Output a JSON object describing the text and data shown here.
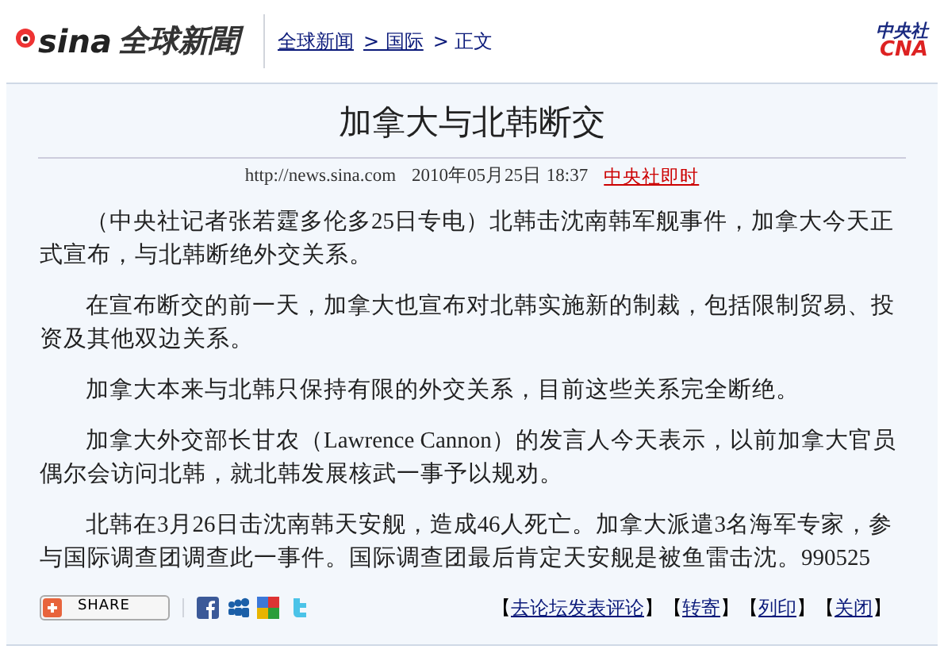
{
  "header": {
    "logo_word": "sina",
    "logo_text": "全球新聞",
    "breadcrumb": [
      {
        "label": "全球新闻",
        "link": true
      },
      {
        "label": "> 国际",
        "link": true
      },
      {
        "label": "> 正文",
        "link": false
      }
    ],
    "partner_logo": {
      "line1": "中央社",
      "line2": "CNA"
    }
  },
  "article": {
    "title": "加拿大与北韩断交",
    "source_url": "http://news.sina.com",
    "date": "2010年05月25日 18:37",
    "source": "中央社即时",
    "paragraphs": [
      "（中央社记者张若霆多伦多25日专电）北韩击沈南韩军舰事件，加拿大今天正式宣布，与北韩断绝外交关系。",
      "在宣布断交的前一天，加拿大也宣布对北韩实施新的制裁，包括限制贸易、投资及其他双边关系。",
      "加拿大本来与北韩只保持有限的外交关系，目前这些关系完全断绝。",
      "加拿大外交部长甘农（Lawrence Cannon）的发言人今天表示，以前加拿大官员偶尔会访问北韩，就北韩发展核武一事予以规劝。",
      "北韩在3月26日击沈南韩天安舰，造成46人死亡。加拿大派遣3名海军专家，参与国际调查团调查此一事件。国际调查团最后肯定天安舰是被鱼雷击沈。990525"
    ]
  },
  "footer": {
    "share_label": "SHARE",
    "social": [
      {
        "kind": "facebook"
      },
      {
        "kind": "myspace"
      },
      {
        "kind": "google"
      },
      {
        "kind": "twitter"
      }
    ],
    "links": [
      {
        "open": "【",
        "label": "去论坛发表评论",
        "close": "】"
      },
      {
        "open": "【",
        "label": "转寄",
        "close": "】"
      },
      {
        "open": "【",
        "label": "列印",
        "close": "】"
      },
      {
        "open": "【",
        "label": "关闭",
        "close": "】"
      }
    ]
  }
}
